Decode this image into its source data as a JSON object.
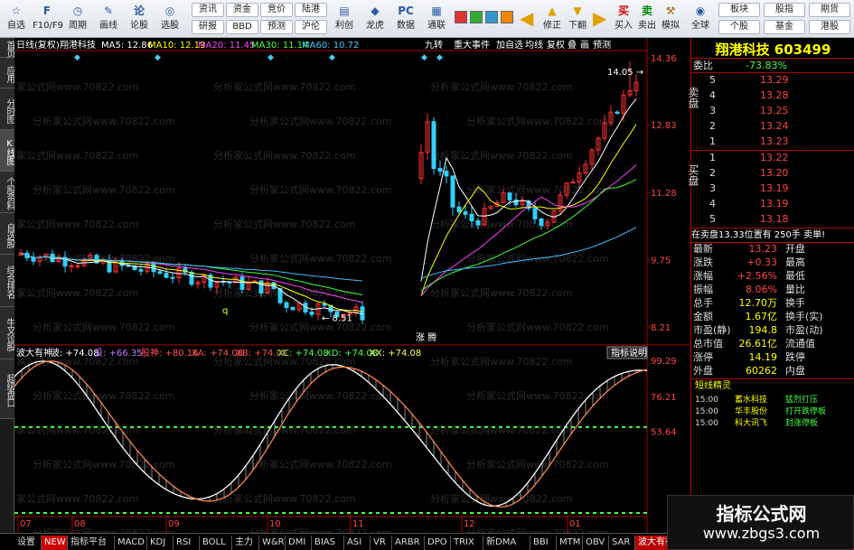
{
  "toolbar": {
    "buttons": [
      {
        "label": "自选",
        "icon": "watchlist-icon",
        "glyph": "☆"
      },
      {
        "label": "F10/F9",
        "icon": "f10-icon",
        "glyph": "F"
      },
      {
        "label": "周期",
        "icon": "period-icon",
        "glyph": "◷"
      },
      {
        "label": "画线",
        "icon": "draw-line-icon",
        "glyph": "✎"
      },
      {
        "label": "论股",
        "icon": "discuss-icon",
        "glyph": "论"
      },
      {
        "label": "选股",
        "icon": "stock-select-icon",
        "glyph": "◎"
      }
    ],
    "small_top": [
      "资讯",
      "资金",
      "竞价",
      "陆港"
    ],
    "small_bottom": [
      "研报",
      "BBD",
      "预测",
      "沪伦"
    ],
    "mid_buttons": [
      {
        "label": "利创",
        "icon": "chart-icon",
        "glyph": "▤"
      },
      {
        "label": "龙虎",
        "icon": "dragon-tiger-icon",
        "glyph": "◆"
      },
      {
        "label": "数据",
        "icon": "data-icon",
        "glyph": "PC"
      },
      {
        "label": "通联",
        "icon": "network-icon",
        "glyph": "▦"
      }
    ],
    "nav_buttons": [
      {
        "label": "修正",
        "icon": "up-arrow-icon",
        "glyph": "▲"
      },
      {
        "label": "下翻",
        "icon": "down-arrow-icon",
        "glyph": "▼"
      }
    ],
    "trade_buttons": [
      {
        "label": "买入",
        "icon": "buy-icon",
        "glyph": "买"
      },
      {
        "label": "卖出",
        "icon": "sell-icon",
        "glyph": "卖"
      },
      {
        "label": "模拟",
        "icon": "simulate-icon",
        "glyph": "⚒"
      }
    ],
    "global_label": "全球",
    "right_top": [
      "板块",
      "股指",
      "期货"
    ],
    "right_bottom": [
      "个股",
      "基金",
      "港股"
    ]
  },
  "sidebar": [
    "首页",
    "应用",
    "分时图",
    "K线图",
    "个股资料",
    "自选股",
    "综合排名",
    "牛叉诊股",
    "超级盘口"
  ],
  "chart_header": {
    "period": "日线(复权)",
    "name": "翔港科技",
    "ma5": "MA5: 12.86",
    "ma10": "MA10: 12.19",
    "ma20": "MA20: 11.45",
    "ma30": "MA30: 11.14",
    "ma60": "MA60: 10.72",
    "menu": [
      "九转",
      "重大事件",
      "加自选",
      "均线",
      "复权",
      "叠",
      "画",
      "预测"
    ]
  },
  "price_axis": [
    "14.36",
    "12.83",
    "11.28",
    "9.75",
    "8.21"
  ],
  "price_labels": {
    "high": "14.05",
    "low": "8.51",
    "q": "q",
    "zt": "涨 腾"
  },
  "indicator_header": {
    "name": "波大有神",
    "items": [
      {
        "t": "波: +74.08",
        "c": "#ffffff"
      },
      {
        "t": "投: +66.35",
        "c": "#c07cff"
      },
      {
        "t": "股神: +80.16",
        "c": "#ff5050"
      },
      {
        "t": "XA: +74.08",
        "c": "#ff5050"
      },
      {
        "t": "XB: +74.08",
        "c": "#ff5050"
      },
      {
        "t": "XC: +74.08",
        "c": "#50ff50"
      },
      {
        "t": "XD: +74.08",
        "c": "#50ff50"
      },
      {
        "t": "XX: +74.08",
        "c": "#ffff50"
      }
    ],
    "help": "指标说明"
  },
  "ind_axis": [
    "99.29",
    "76.21",
    "53.64"
  ],
  "watermark": "分析家公式网www.70822.com",
  "months": [
    "07",
    "08",
    "09",
    "10",
    "11",
    "12",
    "01"
  ],
  "right_panel": {
    "title": "翔港科技 603499",
    "weibi_label": "委比",
    "weibi": "-73.83%",
    "sell_label": "卖盘",
    "buy_label": "买盘",
    "asks": [
      [
        "5",
        "13.29"
      ],
      [
        "4",
        "13.28"
      ],
      [
        "3",
        "13.25"
      ],
      [
        "2",
        "13.24"
      ],
      [
        "1",
        "13.23"
      ]
    ],
    "bids": [
      [
        "1",
        "13.22"
      ],
      [
        "2",
        "13.20"
      ],
      [
        "3",
        "13.19"
      ],
      [
        "4",
        "13.19"
      ],
      [
        "5",
        "13.18"
      ]
    ],
    "pending": "在卖盘13.33位置有  250手  卖単!",
    "stats": [
      [
        "最新",
        "13.23",
        "开盘",
        ""
      ],
      [
        "涨跌",
        "+0.33",
        "最高",
        ""
      ],
      [
        "涨幅",
        "+2.56%",
        "最低",
        ""
      ],
      [
        "振幅",
        "8.06%",
        "量比",
        ""
      ],
      [
        "总手",
        "12.70万",
        "换手",
        ""
      ],
      [
        "金额",
        "1.67亿",
        "换手(实)",
        ""
      ],
      [
        "市盈(静)",
        "194.8",
        "市盈(动)",
        ""
      ],
      [
        "总市值",
        "26.61亿",
        "流通值",
        ""
      ],
      [
        "涨停",
        "14.19",
        "跌停",
        ""
      ],
      [
        "外盘",
        "60262",
        "内盘",
        ""
      ]
    ],
    "elf_title": "短线精灵",
    "elf": [
      [
        "15:00",
        "蓄水科技",
        "猛烈打压"
      ],
      [
        "15:00",
        "华丰股份",
        "打开跌停板"
      ],
      [
        "15:00",
        "科大讯飞",
        "封涨停板"
      ]
    ]
  },
  "bottom_tabs": [
    "设置",
    "NEW",
    "指标平台",
    "MACD",
    "KDJ",
    "RSI",
    "BOLL",
    "主力",
    "W&R",
    "DMI",
    "BIAS",
    "ASI",
    "VR",
    "ARBR",
    "DPO",
    "TRIX",
    "新DMA",
    "BBI",
    "MTM",
    "OBV",
    "SAR",
    "波大有神"
  ],
  "logo": {
    "title": "指标公式网",
    "url": "www.zbgs3.com"
  },
  "colors": {
    "up": "#ff3030",
    "down": "#30d0ff",
    "ma5": "#ffffff",
    "ma10": "#ffff00",
    "ma20": "#ff40ff",
    "ma30": "#40ff40",
    "ma60": "#40c0ff",
    "accent": "#ffff00"
  }
}
